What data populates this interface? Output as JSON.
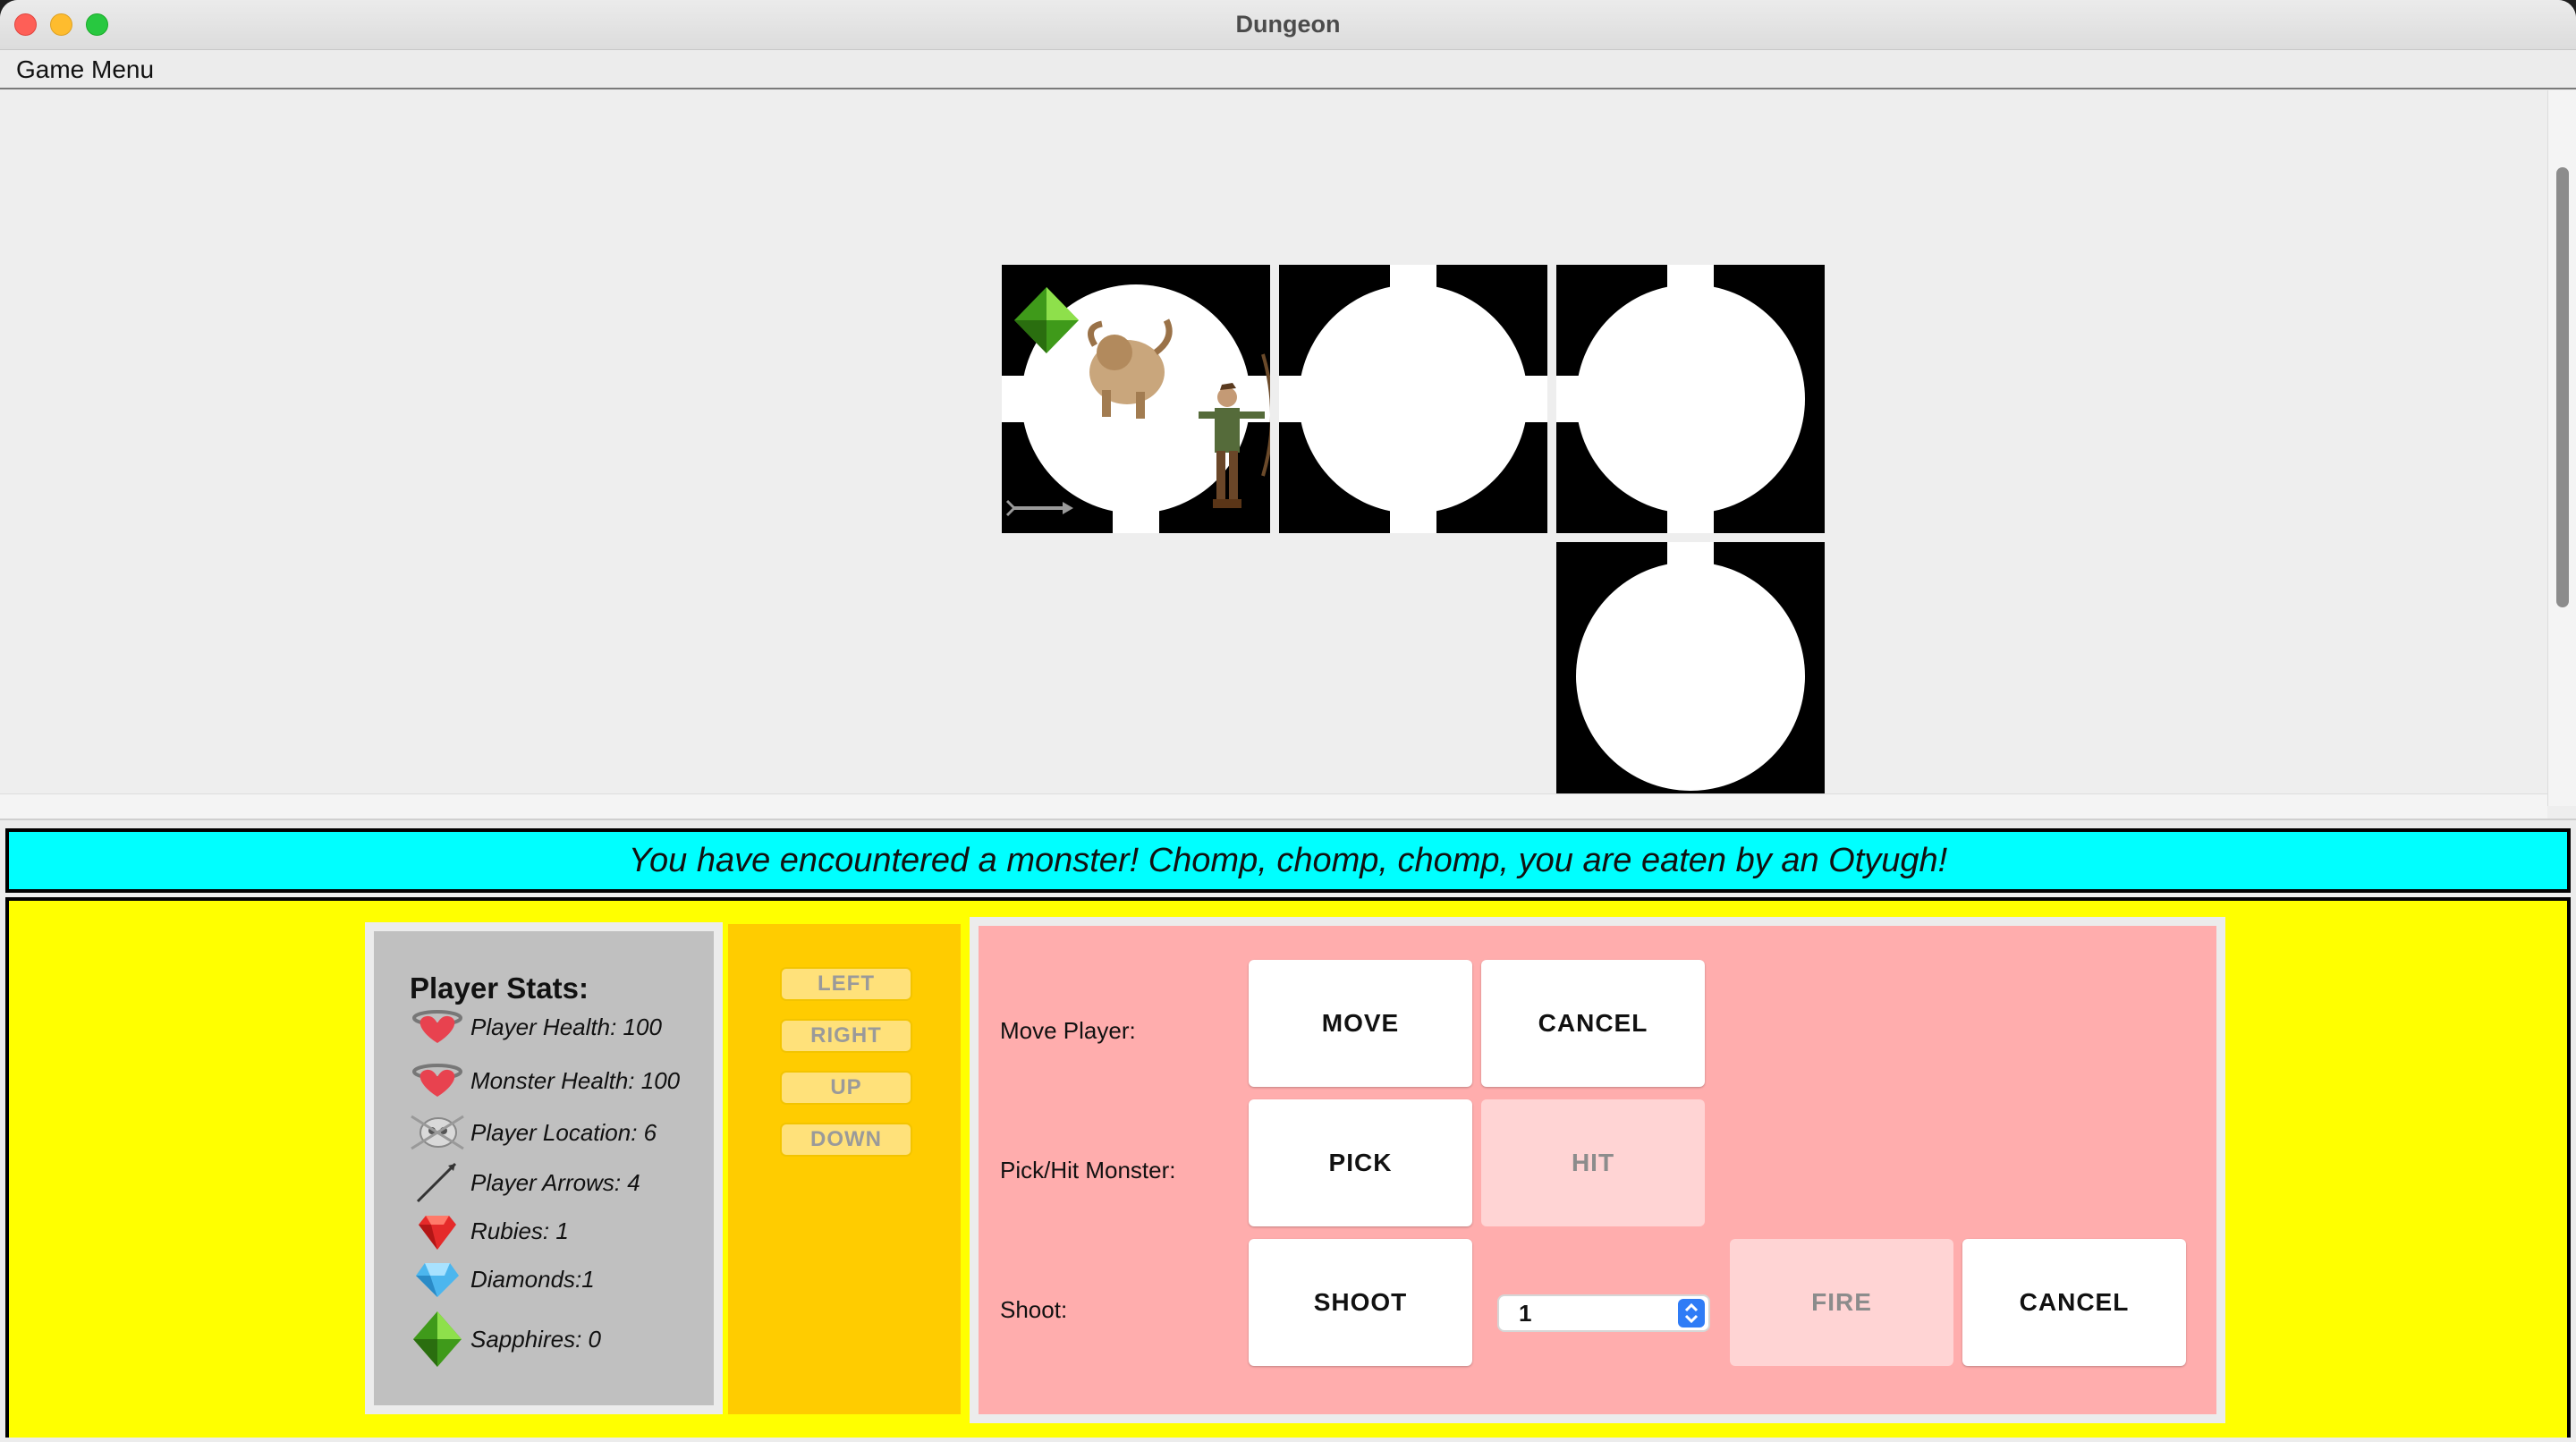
{
  "window": {
    "title": "Dungeon"
  },
  "menubar": {
    "game_menu": "Game Menu"
  },
  "status": {
    "message": "You have encountered a monster! Chomp, chomp, chomp, you are eaten by an Otyugh!"
  },
  "stats": {
    "title": "Player Stats:",
    "player_health": "Player Health: 100",
    "monster_health": "Monster Health: 100",
    "player_location": "Player Location: 6",
    "player_arrows": "Player Arrows: 4",
    "rubies": "Rubies: 1",
    "diamonds": "Diamonds:1",
    "sapphires": "Sapphires: 0"
  },
  "directions": {
    "left": "LEFT",
    "right": "RIGHT",
    "up": "UP",
    "down": "DOWN"
  },
  "actions": {
    "move_label": "Move Player:",
    "move": "MOVE",
    "move_cancel": "CANCEL",
    "pick_label": "Pick/Hit Monster:",
    "pick": "PICK",
    "hit": "HIT",
    "shoot_label": "Shoot:",
    "shoot": "SHOOT",
    "distance_value": "1",
    "fire": "FIRE",
    "shoot_cancel": "CANCEL"
  },
  "colors": {
    "status_bg": "#00ffff",
    "control_bg": "#ffff00",
    "stats_bg": "#c0c0c0",
    "direction_bg": "#ffcc00",
    "actions_bg": "#ffadad"
  }
}
